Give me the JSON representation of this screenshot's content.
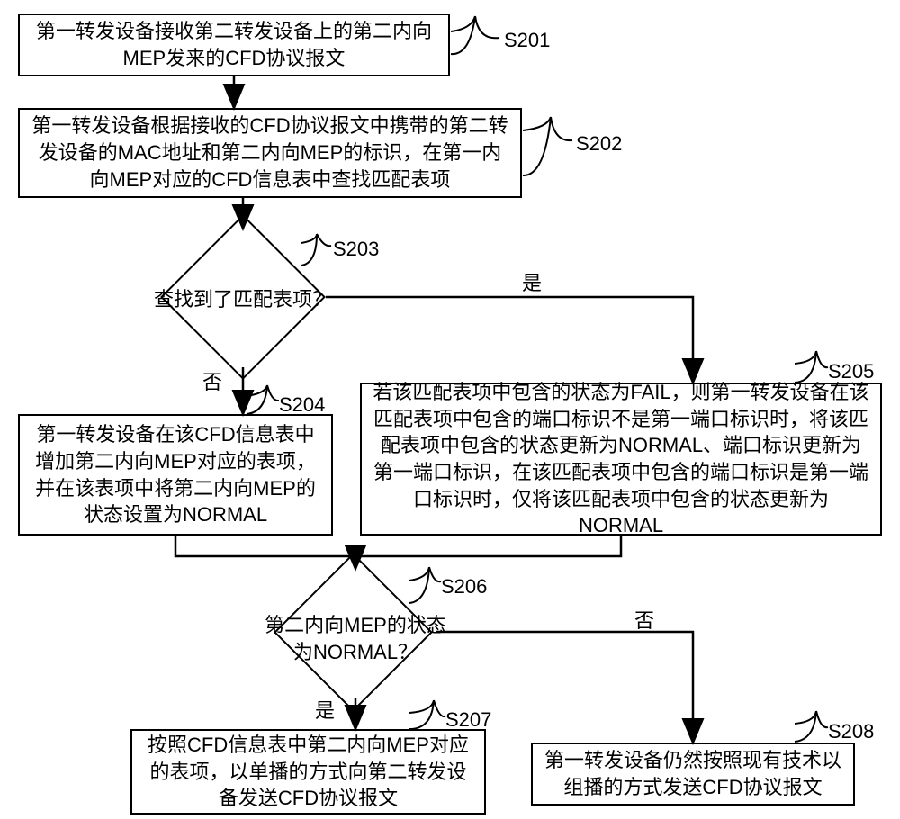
{
  "steps": {
    "s201": {
      "id": "S201",
      "text": "第一转发设备接收第二转发设备上的第二内向MEP发来的CFD协议报文"
    },
    "s202": {
      "id": "S202",
      "text": "第一转发设备根据接收的CFD协议报文中携带的第二转发设备的MAC地址和第二内向MEP的标识，在第一内向MEP对应的CFD信息表中查找匹配表项"
    },
    "s203": {
      "id": "S203",
      "text": "查找到了匹配表项？",
      "yes": "是",
      "no": "否"
    },
    "s204": {
      "id": "S204",
      "text": "第一转发设备在该CFD信息表中增加第二内向MEP对应的表项，并在该表项中将第二内向MEP的状态设置为NORMAL"
    },
    "s205": {
      "id": "S205",
      "text": "若该匹配表项中包含的状态为FAIL，则第一转发设备在该匹配表项中包含的端口标识不是第一端口标识时，将该匹配表项中包含的状态更新为NORMAL、端口标识更新为第一端口标识，在该匹配表项中包含的端口标识是第一端口标识时，仅将该匹配表项中包含的状态更新为NORMAL"
    },
    "s206": {
      "id": "S206",
      "text": "第二内向MEP的状态为NORMAL？",
      "yes": "是",
      "no": "否"
    },
    "s207": {
      "id": "S207",
      "text": "按照CFD信息表中第二内向MEP对应的表项，以单播的方式向第二转发设备发送CFD协议报文"
    },
    "s208": {
      "id": "S208",
      "text": "第一转发设备仍然按照现有技术以组播的方式发送CFD协议报文"
    }
  }
}
